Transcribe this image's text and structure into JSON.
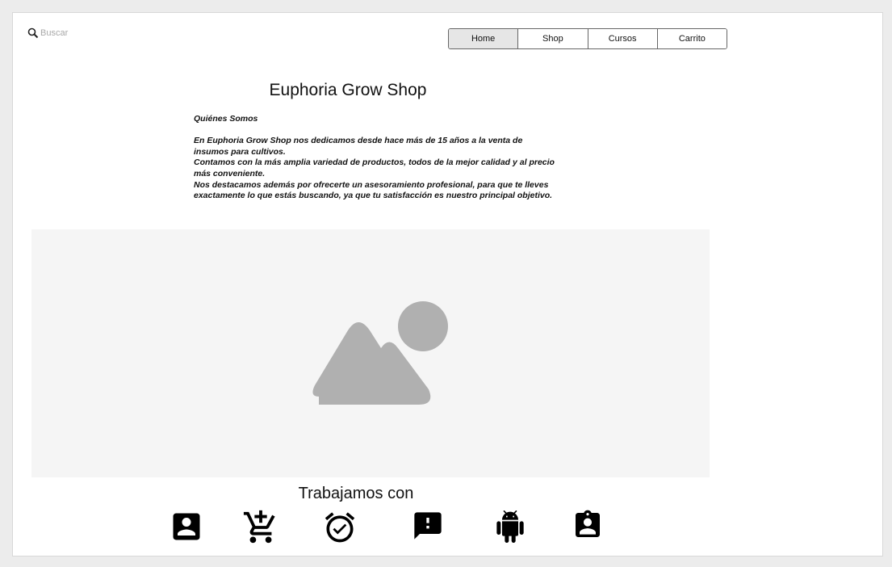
{
  "search": {
    "placeholder": "Buscar"
  },
  "nav": {
    "items": [
      {
        "label": "Home"
      },
      {
        "label": "Shop"
      },
      {
        "label": "Cursos"
      },
      {
        "label": "Carrito"
      }
    ],
    "active": "Home"
  },
  "page": {
    "title": "Euphoria Grow Shop",
    "about_heading": "Quiénes Somos",
    "about_paragraphs": [
      "En Euphoria Grow Shop nos dedicamos desde hace más de 15 años a la venta de insumos para cultivos.",
      "Contamos con la más amplia variedad de productos, todos de la mejor calidad y al precio más conveniente.",
      "Nos destacamos además por ofrecerte un asesoramiento profesional, para que te lleves exactamente lo que estás buscando, ya que tu satisfacción es nuestro principal objetivo."
    ],
    "partners_title": "Trabajamos con"
  },
  "icons": [
    "account-box-icon",
    "add-shopping-cart-icon",
    "alarm-on-icon",
    "feedback-icon",
    "android-icon",
    "assignment-ind-icon",
    "search-icon",
    "image-placeholder-icon"
  ],
  "colors": {
    "background": "#ececec",
    "canvas": "#ffffff",
    "nav_active": "#e6e6e6",
    "icon": "#000000",
    "placeholder_fill": "#b0b0b0"
  }
}
